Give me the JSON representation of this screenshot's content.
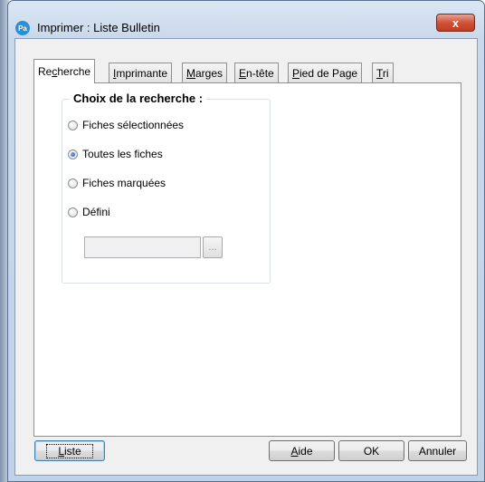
{
  "window": {
    "title": "Imprimer : Liste Bulletin",
    "app_icon_text": "Pa",
    "close_label": "x"
  },
  "tabs": [
    {
      "pre": "Re",
      "ul": "c",
      "post": "herche",
      "active": true
    },
    {
      "pre": "",
      "ul": "I",
      "post": "mprimante",
      "active": false
    },
    {
      "pre": "",
      "ul": "M",
      "post": "arges",
      "active": false
    },
    {
      "pre": "",
      "ul": "E",
      "post": "n-tête",
      "active": false
    },
    {
      "pre": "",
      "ul": "P",
      "post": "ied de Page",
      "active": false
    },
    {
      "pre": "",
      "ul": "T",
      "post": "ri",
      "active": false
    }
  ],
  "search_group": {
    "label": "Choix de la recherche :",
    "options": [
      {
        "label": "Fiches sélectionnées",
        "checked": false
      },
      {
        "label": "Toutes les fiches",
        "checked": true
      },
      {
        "label": "Fiches marquées",
        "checked": false
      },
      {
        "label": "Défini",
        "checked": false
      }
    ],
    "defined_value": "",
    "ellipsis_label": "..."
  },
  "buttons": {
    "liste": {
      "ul": "L",
      "rest": "iste"
    },
    "aide": {
      "ul": "A",
      "rest": "ide"
    },
    "ok": "OK",
    "annuler": "Annuler"
  }
}
